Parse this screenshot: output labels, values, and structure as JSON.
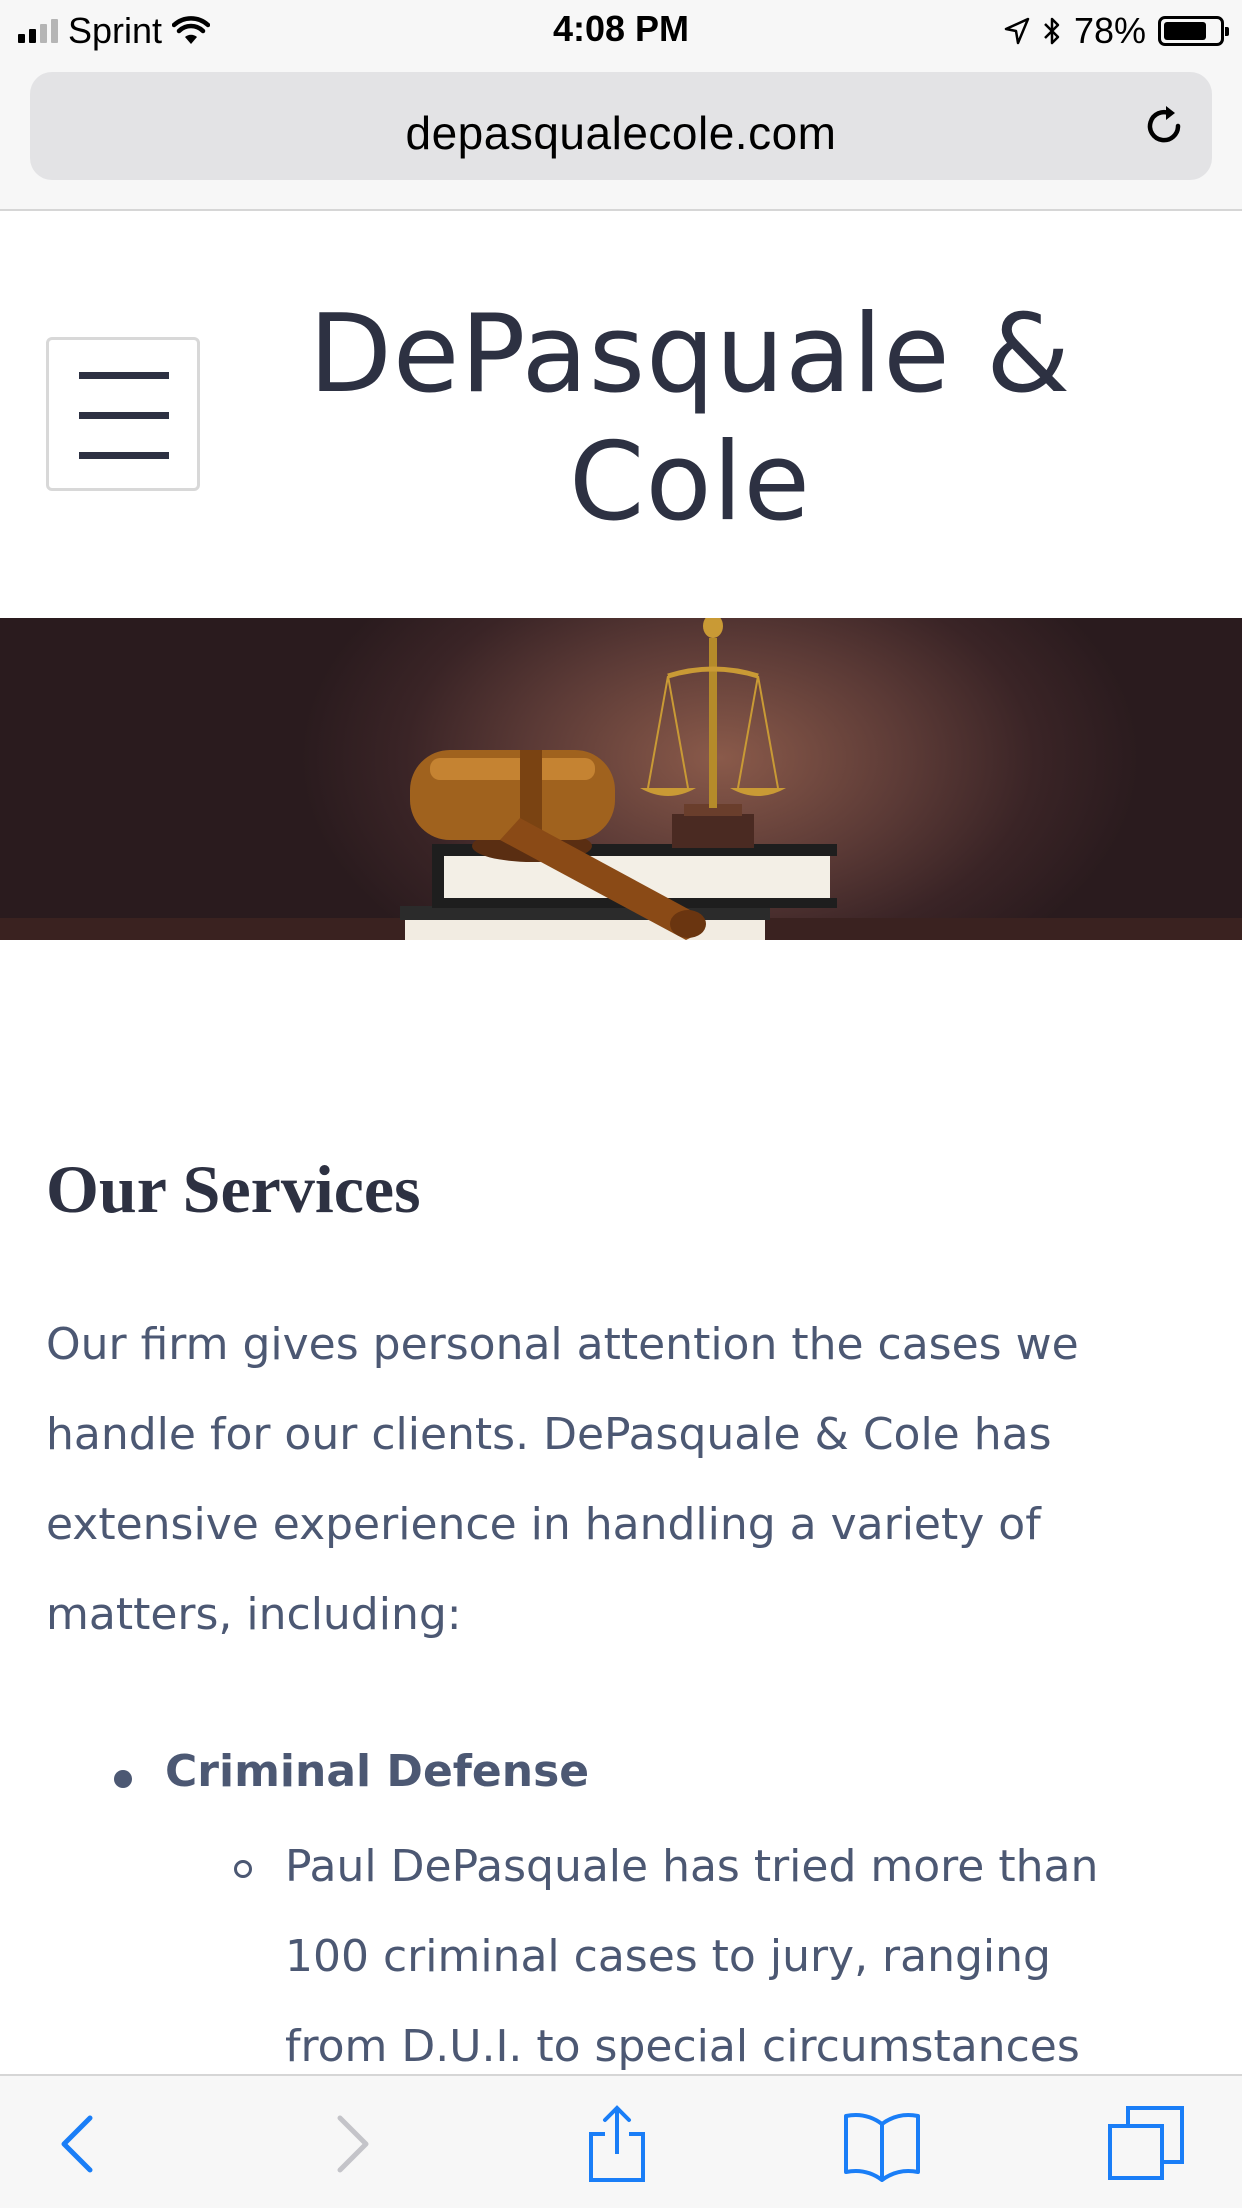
{
  "status_bar": {
    "carrier": "Sprint",
    "time": "4:08 PM",
    "battery_percent": "78%",
    "battery_level": 0.78,
    "icons": [
      "signal-icon",
      "wifi-icon",
      "location-icon",
      "bluetooth-icon",
      "battery-icon"
    ]
  },
  "browser": {
    "url": "depasqualecole.com",
    "reload_icon": "reload-icon"
  },
  "site": {
    "title_line1": "DePasquale &",
    "title_line2": "Cole",
    "menu_icon": "hamburger-menu-icon"
  },
  "hero": {
    "image": "gavel-scales-books-image"
  },
  "content": {
    "heading": "Our Services",
    "intro_lines": [
      "Our firm gives personal attention the cases we",
      "handle for our clients. DePasquale & Cole has",
      "extensive experience in handling a variety of",
      "matters, including:"
    ],
    "services": [
      {
        "label": "Criminal Defense",
        "sub_lines": [
          "Paul DePasquale has tried more than",
          "100 criminal cases to jury, ranging",
          "from D.U.I. to special circumstances"
        ]
      }
    ]
  },
  "toolbar": {
    "buttons": [
      "back-icon",
      "forward-icon",
      "share-icon",
      "bookmarks-icon",
      "tabs-icon"
    ]
  },
  "colors": {
    "accent": "#1a7ef7",
    "title": "#2d3142",
    "body_text": "#4c5873"
  }
}
